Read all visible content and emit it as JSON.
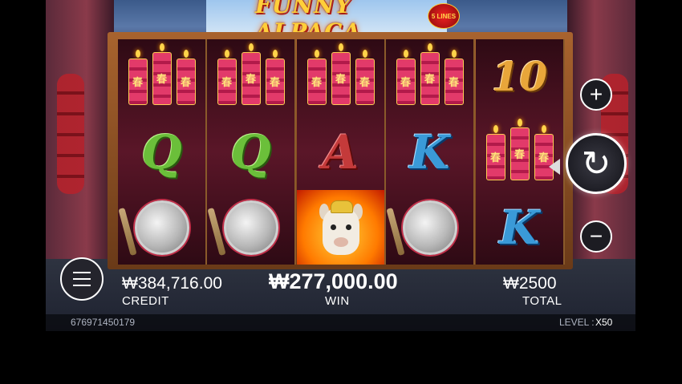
{
  "game": {
    "title": "FUNNY ALPACA",
    "lines_badge": "5 LINES"
  },
  "reels": [
    [
      "fireworks",
      "Q",
      "gong"
    ],
    [
      "fireworks",
      "Q",
      "gong"
    ],
    [
      "fireworks",
      "A",
      "alpaca"
    ],
    [
      "fireworks",
      "K",
      "gong"
    ],
    [
      "10",
      "fireworks",
      "K"
    ]
  ],
  "fireworks_glyph": "春",
  "controls": {
    "plus_icon": "plus-icon",
    "minus_icon": "minus-icon",
    "spin_icon": "refresh-icon",
    "menu_icon": "hamburger-menu-icon"
  },
  "credit": {
    "value": "₩384,716.00",
    "label": "CREDIT"
  },
  "win": {
    "value": "₩277,000.00",
    "label": "WIN"
  },
  "total": {
    "value": "₩2500",
    "label": "TOTAL"
  },
  "footer": {
    "round_id": "676971450179",
    "level_label": "LEVEL :",
    "level_value": "X50"
  },
  "colors": {
    "reel_bg": "#5a1628",
    "frame": "#a8632e",
    "q": "#6bbf3a",
    "a": "#c43a3a",
    "k": "#3a9ad8",
    "ten": "#e8a63a"
  }
}
